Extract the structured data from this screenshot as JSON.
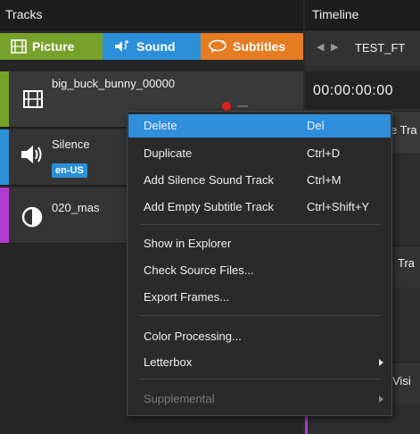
{
  "tracks_panel": {
    "title": "Tracks",
    "tabs": [
      {
        "label": "Picture",
        "icon": "picture-track-icon",
        "color": "#76a12a"
      },
      {
        "label": "Sound",
        "icon": "speaker-plus-icon",
        "color": "#2c90d8"
      },
      {
        "label": "Subtitles",
        "icon": "speech-bubble-icon",
        "color": "#e57c22"
      }
    ],
    "tracks": [
      {
        "name": "big_buck_bunny_00000",
        "icon": "film-icon",
        "color": "#76a12a"
      },
      {
        "name": "Silence",
        "icon": "speaker-icon",
        "badge": "en-US",
        "color": "#2c90d8"
      },
      {
        "name": "020_mas",
        "icon": "contrast-icon",
        "color": "#b23bd0"
      }
    ]
  },
  "timeline_panel": {
    "title": "Timeline",
    "composition_name": "TEST_FT",
    "timecode": "00:00:00:00",
    "row_labels": [
      "e Tra",
      "Tra",
      "Visi"
    ]
  },
  "context_menu": {
    "items": [
      {
        "label": "Delete",
        "shortcut": "Del"
      },
      {
        "label": "Duplicate",
        "shortcut": "Ctrl+D"
      },
      {
        "label": "Add Silence Sound Track",
        "shortcut": "Ctrl+M"
      },
      {
        "label": "Add Empty Subtitle Track",
        "shortcut": "Ctrl+Shift+Y"
      },
      {
        "label": "Show in Explorer"
      },
      {
        "label": "Check Source Files..."
      },
      {
        "label": "Export Frames..."
      },
      {
        "label": "Color Processing..."
      },
      {
        "label": "Letterbox"
      },
      {
        "label": "Supplemental"
      }
    ]
  },
  "colors": {
    "accent_blue": "#2f8fdd",
    "picture_green": "#76a12a",
    "sound_blue": "#2c90d8",
    "subtitle_orange": "#e57c22",
    "subtitle_purple": "#b23bd0"
  }
}
